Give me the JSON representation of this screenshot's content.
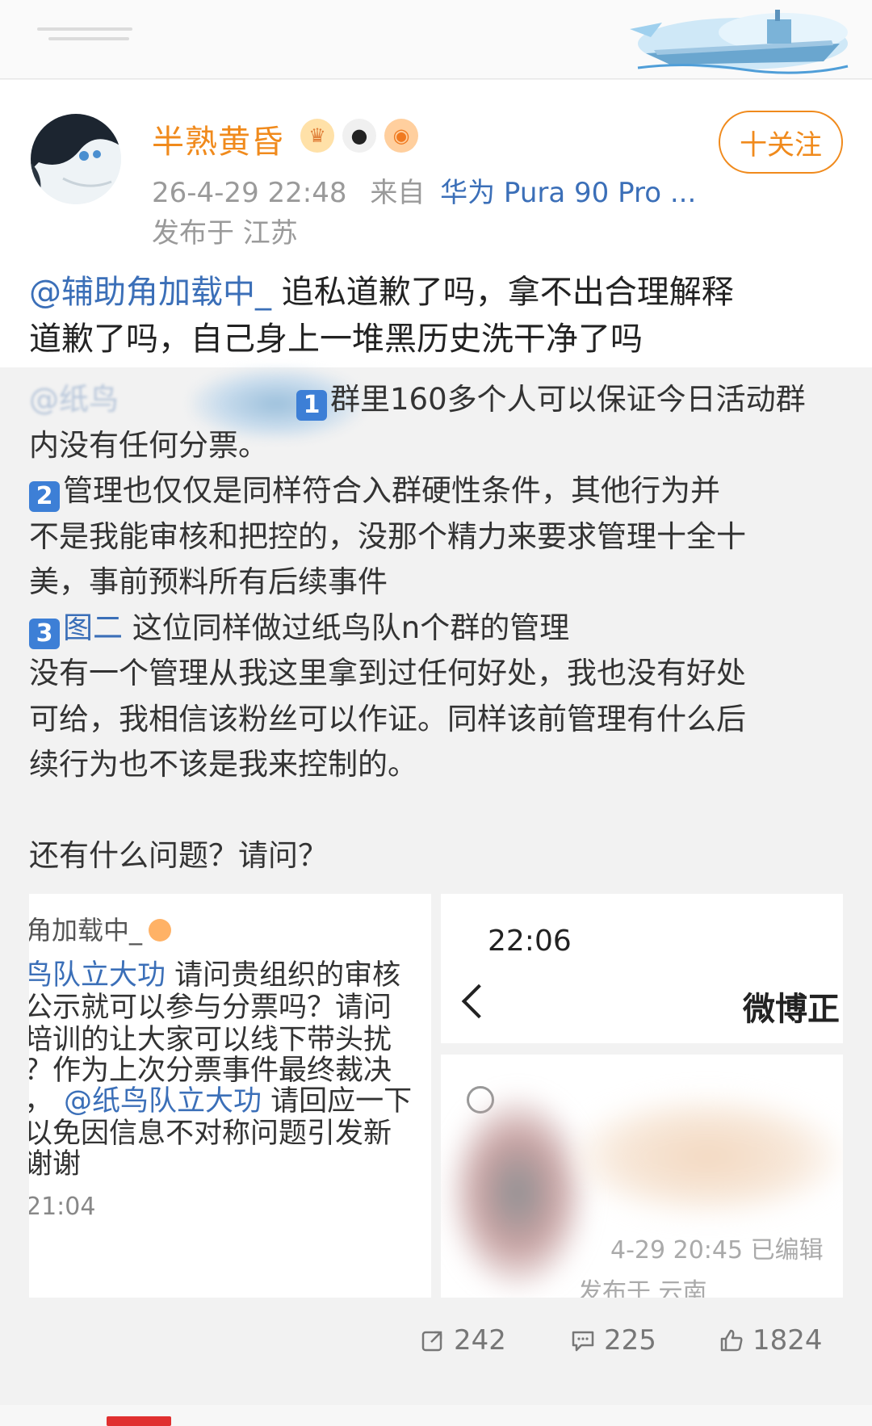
{
  "post": {
    "username": "半熟黄昏",
    "follow_label": "十关注",
    "date": "26-4-29 22:48",
    "source_prefix": "来自",
    "device": "华为 Pura 90 Pro ...",
    "location": "发布于 江苏",
    "badges": [
      "crown-badge-icon",
      "panda-badge-icon",
      "fish-badge-icon"
    ],
    "mention": "@辅助角加载中_",
    "text_line1_rest": " 追私道歉了吗，拿不出合理解释",
    "text_line2": "道歉了吗，自己身上一堆黑历史洗干净了吗"
  },
  "quote": {
    "blurred_mention": "@纸鸟",
    "num1": "1",
    "p1a": "群里160多个人可以保证今日活动群",
    "p1b": "内没有任何分票。",
    "num2": "2",
    "p2a": "管理也仅仅是同样符合入群硬性条件，其他行为并",
    "p2b": "不是我能审核和把控的，没那个精力来要求管理十全十",
    "p2c": "美，事前预料所有后续事件",
    "num3": "3",
    "p3_link": "图二",
    "p3a": " 这位同样做过纸鸟队n个群的管理",
    "p4a": "没有一个管理从我这里拿到过任何好处，我也没有好处",
    "p4b": "可给，我相信该粉丝可以作证。同样该前管理有什么后",
    "p4c": "续行为也不该是我来控制的。",
    "p5": "还有什么问题？请问？"
  },
  "image1": {
    "name": "角加载中_",
    "l1_link": "鸟队立大功",
    "l1_rest": " 请问贵组织的审核",
    "l2": "公示就可以参与分票吗？请问",
    "l3": "培训的让大家可以线下带头扰",
    "l4": "？作为上次分票事件最终裁决",
    "l5_pre": "，",
    "l5_link": "@纸鸟队立大功",
    "l5_rest": " 请回应一下",
    "l6": "以免因信息不对称问题引发新",
    "l7": "谢谢",
    "time": "21:04"
  },
  "image2": {
    "time": "22:06",
    "title": "微博正",
    "stamp": "4-29 20:45  已编辑",
    "location": "发布于 云南"
  },
  "actions": {
    "repost": "242",
    "comment": "225",
    "like": "1824"
  },
  "colors": {
    "accent_orange": "#f08a1c",
    "link_blue": "#3b6fb8",
    "number_badge_blue": "#3d7fd6"
  }
}
